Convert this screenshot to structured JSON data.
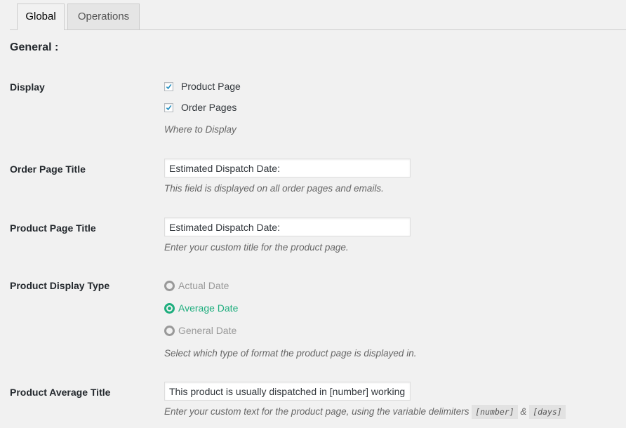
{
  "tabs": [
    {
      "label": "Global",
      "active": true
    },
    {
      "label": "Operations",
      "active": false
    }
  ],
  "section_title": "General :",
  "fields": {
    "display": {
      "label": "Display",
      "options": [
        {
          "label": "Product Page",
          "checked": true
        },
        {
          "label": "Order Pages",
          "checked": true
        }
      ],
      "description": "Where to Display"
    },
    "order_page_title": {
      "label": "Order Page Title",
      "value": "Estimated Dispatch Date:",
      "description": "This field is displayed on all order pages and emails."
    },
    "product_page_title": {
      "label": "Product Page Title",
      "value": "Estimated Dispatch Date:",
      "description": "Enter your custom title for the product page."
    },
    "product_display_type": {
      "label": "Product Display Type",
      "options": [
        {
          "label": "Actual Date",
          "checked": false
        },
        {
          "label": "Average Date",
          "checked": true
        },
        {
          "label": "General Date",
          "checked": false
        }
      ],
      "description": "Select which type of format the product page is displayed in."
    },
    "product_average_title": {
      "label": "Product Average Title",
      "value": "This product is usually dispatched in [number] working [days]",
      "description_prefix": "Enter your custom text for the product page, using the variable delimiters",
      "delimiter_1": "[number]",
      "delimiter_joiner": "&",
      "delimiter_2": "[days]"
    }
  },
  "colors": {
    "accent": "#1fae7e",
    "background": "#f1f1f1"
  }
}
